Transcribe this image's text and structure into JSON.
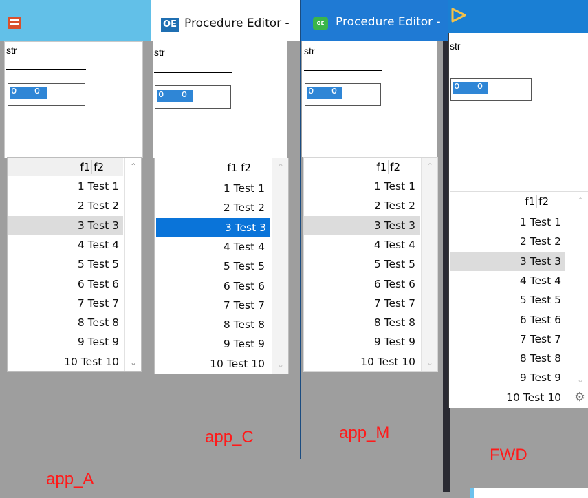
{
  "colors": {
    "background": "#9e9e9e",
    "selection_blue": "#0a74d9",
    "selection_gray": "#dcdcdc",
    "caption_red": "#ff1a1a"
  },
  "browse": {
    "header": [
      "f1",
      "f2"
    ],
    "rows": [
      {
        "f1": "1",
        "f2": "Test 1"
      },
      {
        "f1": "2",
        "f2": "Test 2"
      },
      {
        "f1": "3",
        "f2": "Test 3"
      },
      {
        "f1": "4",
        "f2": "Test 4"
      },
      {
        "f1": "5",
        "f2": "Test 5"
      },
      {
        "f1": "6",
        "f2": "Test 6"
      },
      {
        "f1": "7",
        "f2": "Test 7"
      },
      {
        "f1": "8",
        "f2": "Test 8"
      },
      {
        "f1": "9",
        "f2": "Test 9"
      },
      {
        "f1": "10",
        "f2": "Test 10"
      }
    ],
    "selected_row": 3
  },
  "panes": [
    {
      "id": "app_A",
      "caption": "app_A",
      "title": "",
      "icon": "app-a-icon",
      "label": "str",
      "fill_value": "o   o"
    },
    {
      "id": "app_C",
      "caption": "app_C",
      "title": "Procedure Editor -",
      "icon": "oe-icon",
      "icon_text": "OE",
      "label": "str",
      "fill_value": "o   o"
    },
    {
      "id": "app_M",
      "caption": "app_M",
      "title": "Procedure Editor -",
      "icon": "oe-icon",
      "icon_text": "OE",
      "label": "str",
      "fill_value": "o   o"
    },
    {
      "id": "FWD",
      "caption": "FWD",
      "title": "",
      "icon": "fwd-triangle-icon",
      "label": "str",
      "fill_value": "o   o"
    }
  ]
}
